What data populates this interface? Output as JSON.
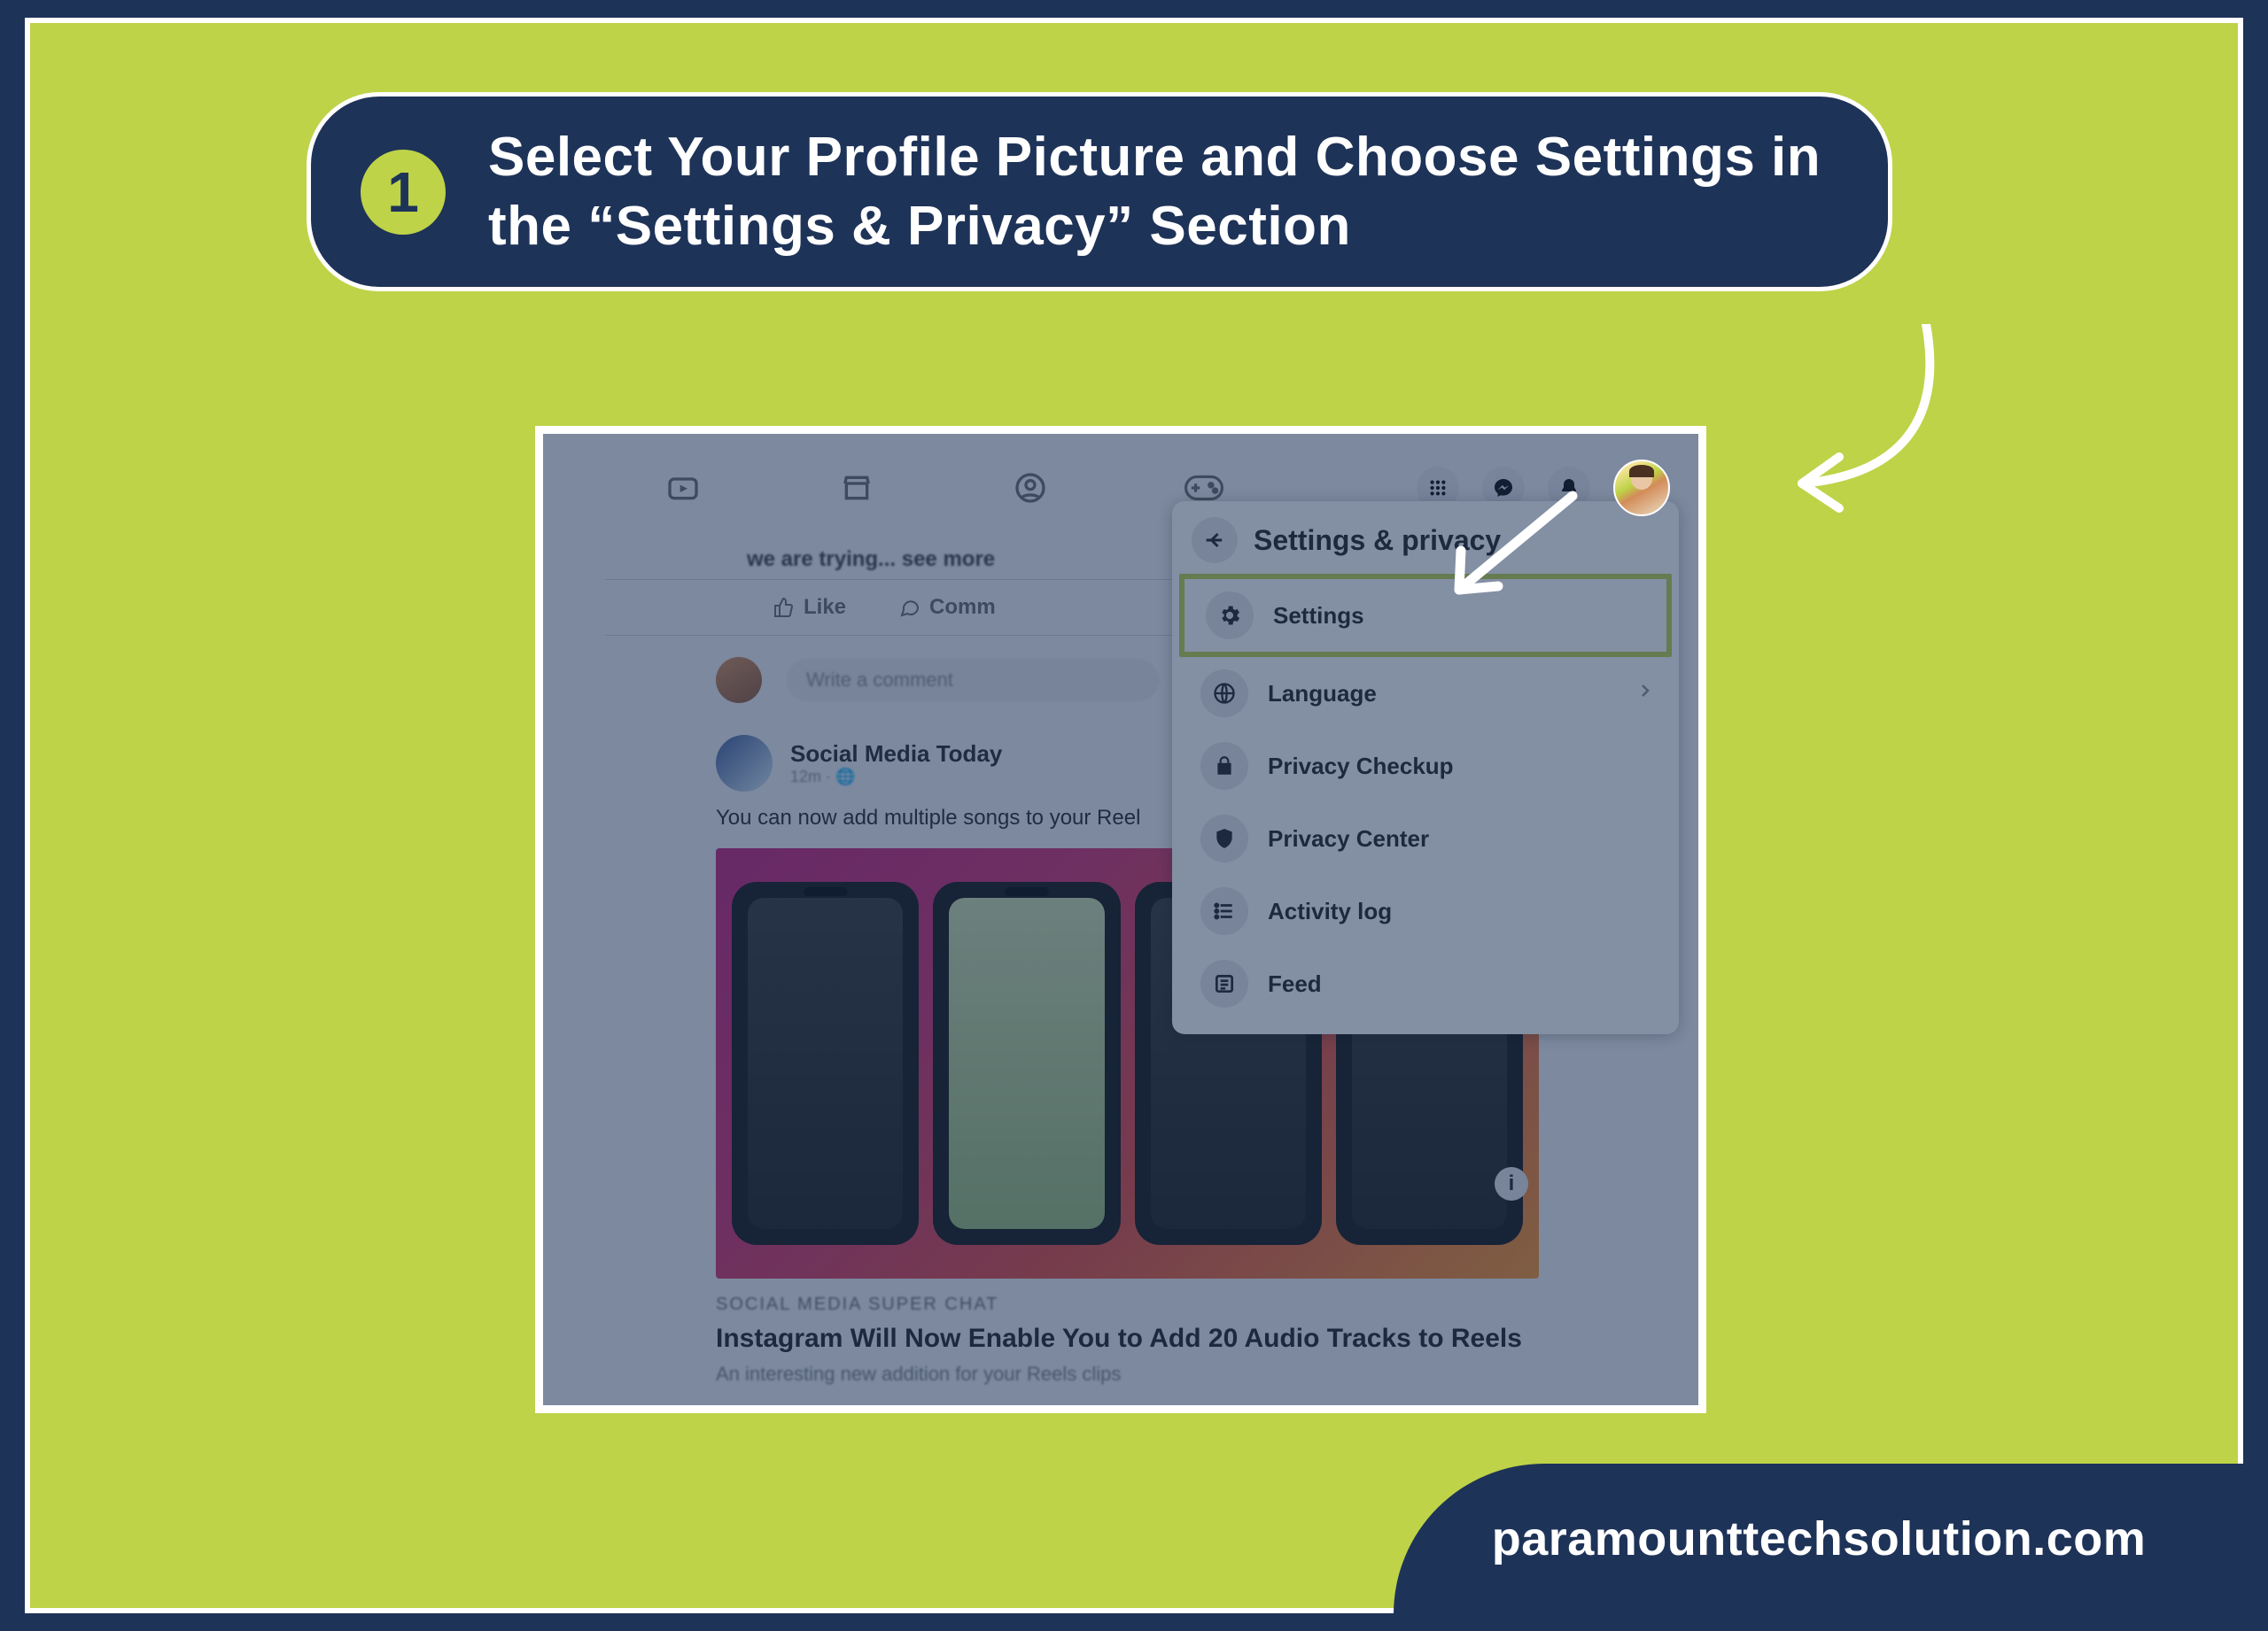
{
  "step": {
    "number": "1",
    "text": "Select Your Profile Picture and Choose Settings in the “Settings & Privacy” Section"
  },
  "fb": {
    "see_more": "we are trying... see more",
    "like": "Like",
    "comment": "Comm",
    "write_comment": "Write a comment",
    "post": {
      "author": "Social Media Today",
      "meta": "12m · 🌐",
      "body": "You can now add multiple songs to your Reel",
      "caption_tag": "SOCIAL MEDIA SUPER CHAT",
      "headline": "Instagram Will Now Enable You to Add 20 Audio Tracks to Reels",
      "subline": "An interesting new addition for your Reels clips"
    },
    "panel": {
      "title": "Settings & privacy",
      "items": {
        "settings": "Settings",
        "language": "Language",
        "privacy_checkup": "Privacy Checkup",
        "privacy_center": "Privacy Center",
        "activity_log": "Activity log",
        "feed": "Feed"
      }
    }
  },
  "website": "paramounttechsolution.com"
}
